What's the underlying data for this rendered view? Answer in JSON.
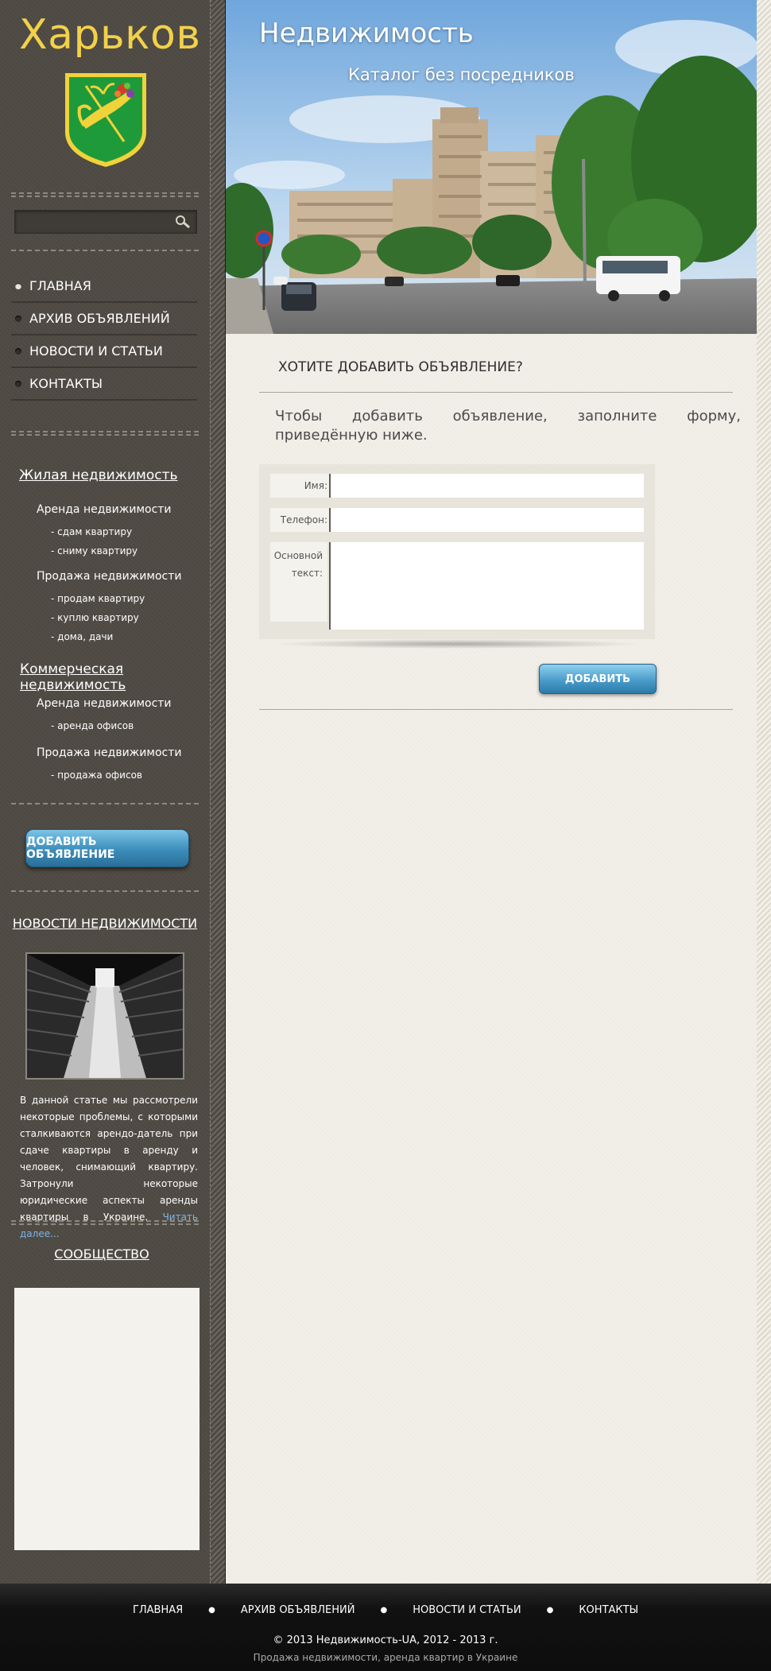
{
  "sidebar": {
    "city": "Харьков",
    "search": {
      "placeholder": ""
    },
    "menu": [
      {
        "label": "ГЛАВНАЯ"
      },
      {
        "label": "АРХИВ ОБЪЯВЛЕНИЙ"
      },
      {
        "label": "НОВОСТИ И СТАТЬИ"
      },
      {
        "label": "КОНТАКТЫ"
      }
    ],
    "categories": {
      "residential": {
        "title": "Жилая недвижимость",
        "rent": "Аренда недвижимости",
        "rent_links": [
          "- сдам квартиру",
          "- сниму квартиру"
        ],
        "sale": "Продажа недвижимости",
        "sale_links": [
          "- продам квартиру",
          "- куплю квартиру",
          "- дома, дачи"
        ]
      },
      "commercial": {
        "title": "Коммерческая недвижимость",
        "rent": "Аренда недвижимости",
        "rent_links": [
          "- аренда офисов"
        ],
        "sale": "Продажа недвижимости",
        "sale_links": [
          "- продажа офисов"
        ]
      }
    },
    "add_ad_button": "ДОБАВИТЬ ОБЪЯВЛЕНИЕ",
    "news": {
      "title": "НОВОСТИ НЕДВИЖИМОСТИ",
      "text": "В данной статье мы рассмотрели некоторые проблемы, с которыми сталкиваются арендо-датель при сдаче квартиры в аренду и человек, снимающий квартиру. Затронули некоторые юридические аспекты аренды квартиры в Украине.",
      "read_more": "Читать далее..."
    },
    "community_title": "СООБЩЕСТВО"
  },
  "header": {
    "site_name": "Недвижимость",
    "slogan": "Каталог без посредников"
  },
  "main": {
    "heading": "ХОТИТЕ ДОБАВИТЬ ОБЪЯВЛЕНИЕ?",
    "intro": "Чтобы добавить объявление, заполните форму, приведённую ниже.",
    "form": {
      "name_label": "Имя:",
      "phone_label": "Телефон:",
      "text_label": "Основной текст:",
      "name_value": "",
      "phone_value": "",
      "text_value": "",
      "submit": "ДОБАВИТЬ"
    }
  },
  "footer": {
    "nav": [
      {
        "label": "ГЛАВНАЯ"
      },
      {
        "label": "АРХИВ ОБЪЯВЛЕНИЙ"
      },
      {
        "label": "НОВОСТИ И СТАТЬИ"
      },
      {
        "label": "КОНТАКТЫ"
      }
    ],
    "separator": "●",
    "copyright": "© 2013 Недвижимость-UA, 2012 - 2013 г.",
    "tagline": "Продажа недвижимости, аренда квартир в Украине"
  },
  "colors": {
    "sidebar_bg": "#4e4a43",
    "city_title": "#f2d14b",
    "button_blue": "#3b8dbb",
    "main_bg": "#f2efe8"
  }
}
